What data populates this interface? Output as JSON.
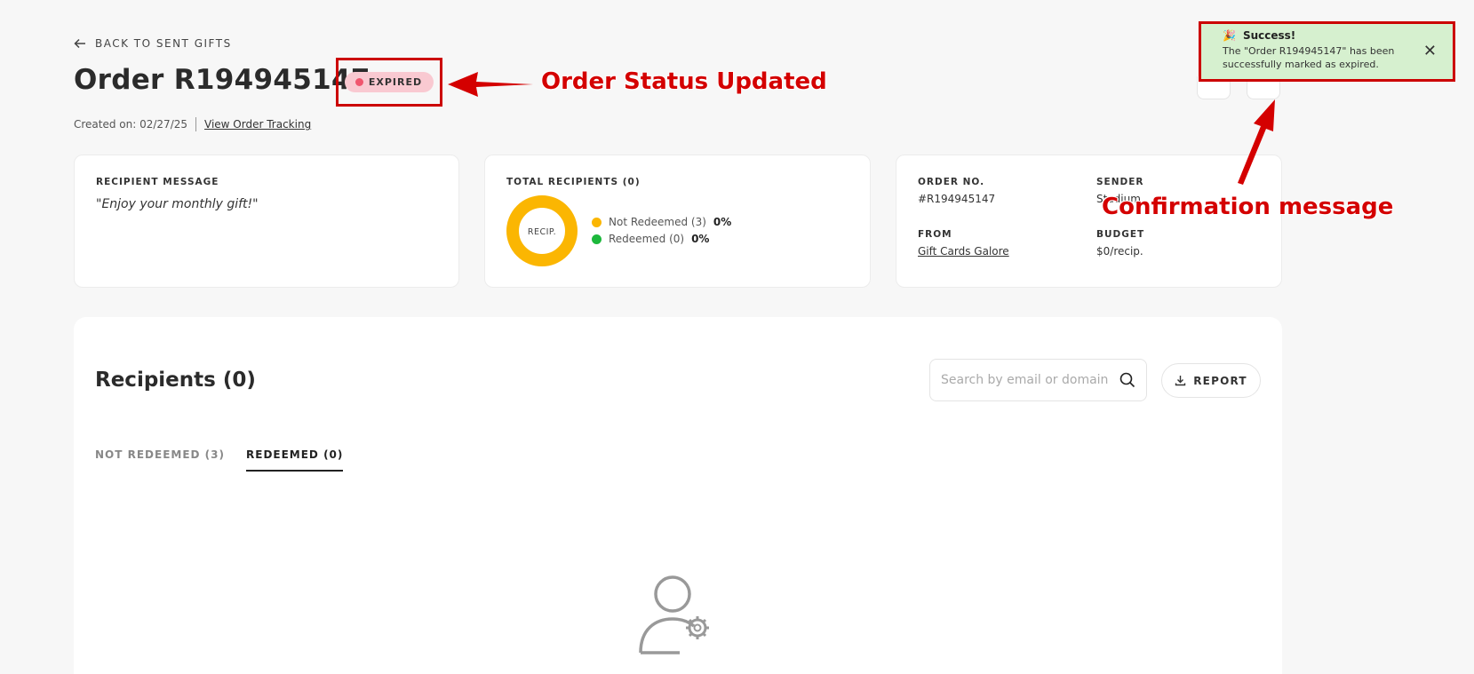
{
  "nav": {
    "back_label": "BACK TO SENT GIFTS"
  },
  "order": {
    "title": "Order R194945147",
    "status": "EXPIRED",
    "created_label": "Created on: 02/27/25",
    "tracking_link": "View Order Tracking"
  },
  "annotations": {
    "status_note": "Order Status Updated",
    "confirmation_note": "Confirmation message"
  },
  "cards": {
    "message": {
      "label": "RECIPIENT MESSAGE",
      "text": "\"Enjoy your monthly gift!\""
    },
    "recipients": {
      "label": "TOTAL RECIPIENTS (0)",
      "donut_label": "RECIP.",
      "legend": [
        {
          "label": "Not Redeemed (3)",
          "pct": "0%",
          "color": "#fbb602"
        },
        {
          "label": "Redeemed (0)",
          "pct": "0%",
          "color": "#1db83c"
        }
      ]
    },
    "info": {
      "order_no_label": "ORDER NO.",
      "order_no": "#R194945147",
      "sender_label": "SENDER",
      "sender": "Stadium",
      "from_label": "FROM",
      "from": "Gift Cards Galore",
      "budget_label": "BUDGET",
      "budget": "$0/recip."
    }
  },
  "recipients_section": {
    "title": "Recipients (0)",
    "search_placeholder": "Search by email or domain",
    "report_label": "REPORT",
    "tabs": [
      {
        "label": "NOT REDEEMED (3)",
        "active": false
      },
      {
        "label": "REDEEMED (0)",
        "active": true
      }
    ]
  },
  "toast": {
    "title": "Success!",
    "message": "The \"Order R194945147\" has been successfully marked as expired."
  },
  "colors": {
    "annotation_red": "#cc0000",
    "expired_badge": "#f9c9d1",
    "toast_bg": "#d6f0cf",
    "not_redeemed": "#fbb602",
    "redeemed": "#1db83c"
  }
}
